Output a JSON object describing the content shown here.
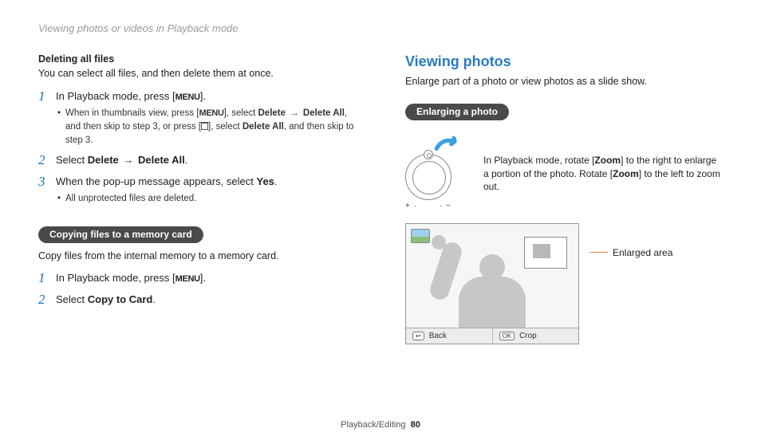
{
  "header": "Viewing photos or videos in Playback mode",
  "left": {
    "subhead": "Deleting all files",
    "intro": "You can select all files, and then delete them at once.",
    "steps": [
      {
        "num": "1",
        "prefix": "In Playback mode, press [",
        "menu": "MENU",
        "suffix": "].",
        "sub_a": "When in thumbnails view, press [",
        "sub_b": "], select ",
        "sub_delete": "Delete",
        "sub_c": " → ",
        "sub_delall": "Delete All",
        "sub_d": ", and then skip to step 3, or press [",
        "sub_e": "], select ",
        "sub_delall2": "Delete All",
        "sub_f": ", and then skip to step 3."
      },
      {
        "num": "2",
        "prefix": "Select ",
        "b1": "Delete",
        "mid": " → ",
        "b2": "Delete All",
        "suffix": "."
      },
      {
        "num": "3",
        "prefix": "When the pop-up message appears, select ",
        "b1": "Yes",
        "suffix": ".",
        "sub": "All unprotected files are deleted."
      }
    ],
    "pill": "Copying files to a memory card",
    "copy_intro": "Copy files from the internal memory to a memory card.",
    "copy_steps": [
      {
        "num": "1",
        "prefix": "In Playback mode, press [",
        "menu": "MENU",
        "suffix": "]."
      },
      {
        "num": "2",
        "prefix": "Select ",
        "b1": "Copy to Card",
        "suffix": "."
      }
    ]
  },
  "right": {
    "title": "Viewing photos",
    "intro": "Enlarge part of a photo or view photos as a slide show.",
    "pill": "Enlarging a photo",
    "zoom_a": "In Playback mode, rotate [",
    "zoom_b": "Zoom",
    "zoom_c": "] to the right to enlarge a portion of the photo. Rotate [",
    "zoom_d": "Zoom",
    "zoom_e": "] to the left to zoom out.",
    "dial_plus": "+",
    "dial_dot": "·",
    "dial_minus": "−",
    "back_label": "Back",
    "crop_label": "Crop",
    "callout": "Enlarged area",
    "back_icon": "↩",
    "crop_icon": "OK"
  },
  "footer": {
    "section": "Playback/Editing",
    "page": "80"
  }
}
